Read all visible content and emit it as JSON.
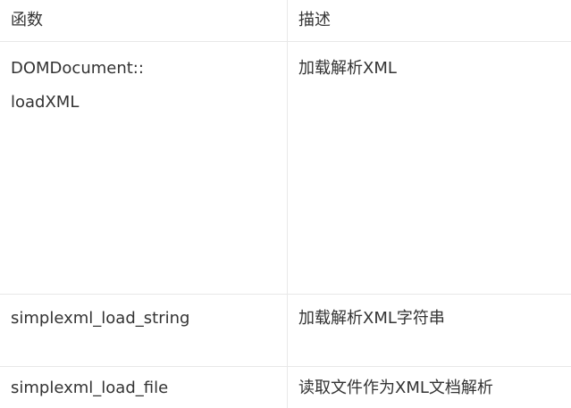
{
  "table": {
    "headers": [
      "函数",
      "描述"
    ],
    "rows": [
      {
        "function_lines": [
          "DOMDocument::",
          "loadXML"
        ],
        "description": "加载解析XML"
      },
      {
        "function_lines": [
          "simplexml_load_string"
        ],
        "description": "加载解析XML字符串"
      },
      {
        "function_lines": [
          "simplexml_load_file"
        ],
        "description": "读取文件作为XML文档解析"
      }
    ]
  },
  "colors": {
    "text": "#333333",
    "border": "#e8e8e8",
    "background": "#ffffff"
  }
}
